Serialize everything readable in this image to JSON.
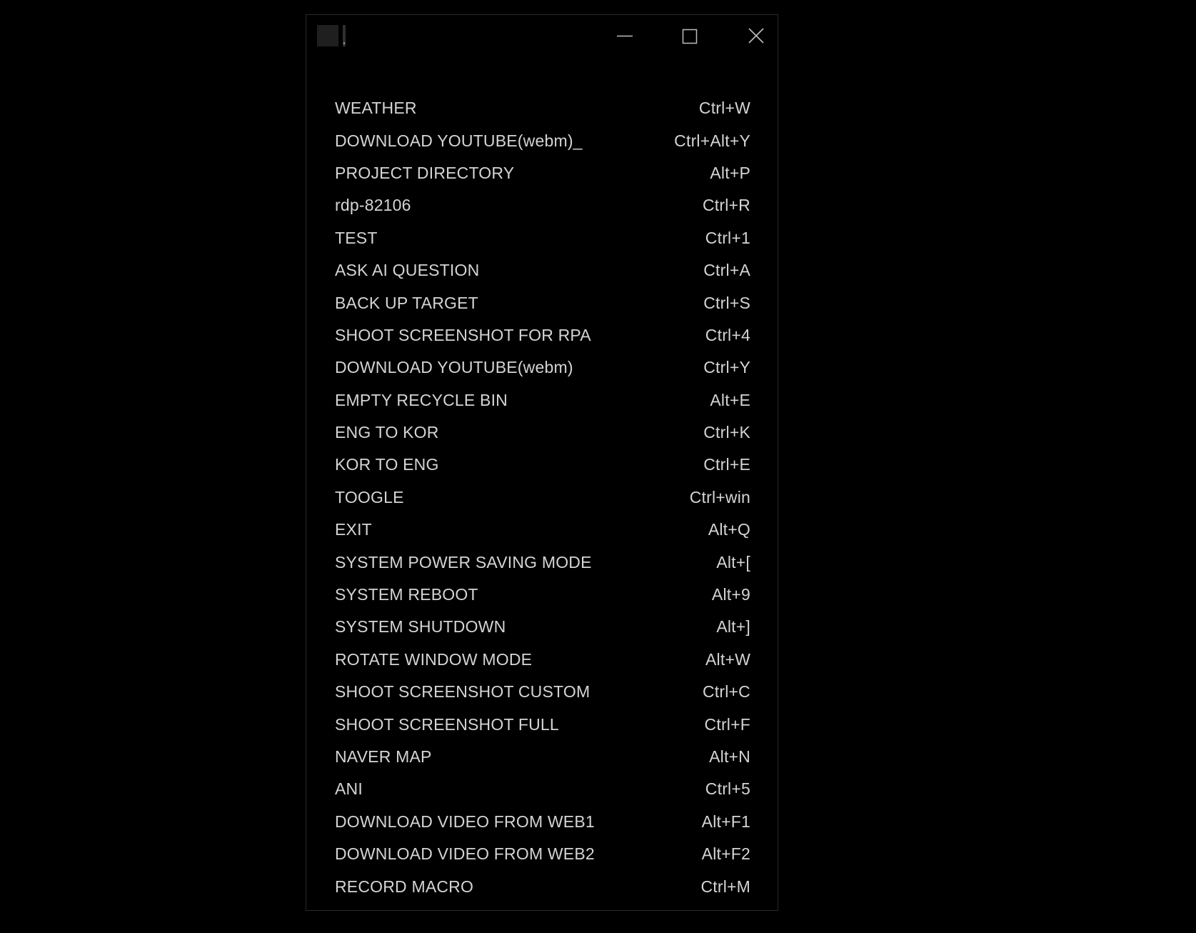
{
  "window": {
    "controls": {
      "minimize_icon": "minimize-icon",
      "maximize_icon": "maximize-icon",
      "close_icon": "close-icon"
    }
  },
  "menu": {
    "items": [
      {
        "label": "WEATHER",
        "shortcut": "Ctrl+W"
      },
      {
        "label": "DOWNLOAD YOUTUBE(webm)_",
        "shortcut": "Ctrl+Alt+Y"
      },
      {
        "label": "PROJECT DIRECTORY",
        "shortcut": "Alt+P"
      },
      {
        "label": "rdp-82106",
        "shortcut": "Ctrl+R"
      },
      {
        "label": "TEST",
        "shortcut": "Ctrl+1"
      },
      {
        "label": "ASK AI QUESTION",
        "shortcut": "Ctrl+A"
      },
      {
        "label": "BACK UP TARGET",
        "shortcut": "Ctrl+S"
      },
      {
        "label": "SHOOT SCREENSHOT FOR RPA",
        "shortcut": "Ctrl+4"
      },
      {
        "label": "DOWNLOAD YOUTUBE(webm)",
        "shortcut": "Ctrl+Y"
      },
      {
        "label": "EMPTY RECYCLE BIN",
        "shortcut": "Alt+E"
      },
      {
        "label": "ENG TO KOR",
        "shortcut": "Ctrl+K"
      },
      {
        "label": "KOR TO ENG",
        "shortcut": "Ctrl+E"
      },
      {
        "label": "TOOGLE",
        "shortcut": "Ctrl+win"
      },
      {
        "label": "EXIT",
        "shortcut": "Alt+Q"
      },
      {
        "label": "SYSTEM POWER SAVING MODE",
        "shortcut": "Alt+["
      },
      {
        "label": "SYSTEM REBOOT",
        "shortcut": "Alt+9"
      },
      {
        "label": "SYSTEM SHUTDOWN",
        "shortcut": "Alt+]"
      },
      {
        "label": "ROTATE WINDOW MODE",
        "shortcut": "Alt+W"
      },
      {
        "label": "SHOOT SCREENSHOT CUSTOM",
        "shortcut": "Ctrl+C"
      },
      {
        "label": "SHOOT SCREENSHOT FULL",
        "shortcut": "Ctrl+F"
      },
      {
        "label": "NAVER MAP",
        "shortcut": "Alt+N"
      },
      {
        "label": "ANI",
        "shortcut": "Ctrl+5"
      },
      {
        "label": "DOWNLOAD VIDEO FROM WEB1",
        "shortcut": "Alt+F1"
      },
      {
        "label": "DOWNLOAD VIDEO FROM WEB2",
        "shortcut": "Alt+F2"
      },
      {
        "label": "RECORD MACRO",
        "shortcut": "Ctrl+M"
      }
    ]
  },
  "colors": {
    "background": "#000000",
    "text": "#d4d4d4",
    "border": "#2a2a2a",
    "icon": "#bdbdbd"
  }
}
